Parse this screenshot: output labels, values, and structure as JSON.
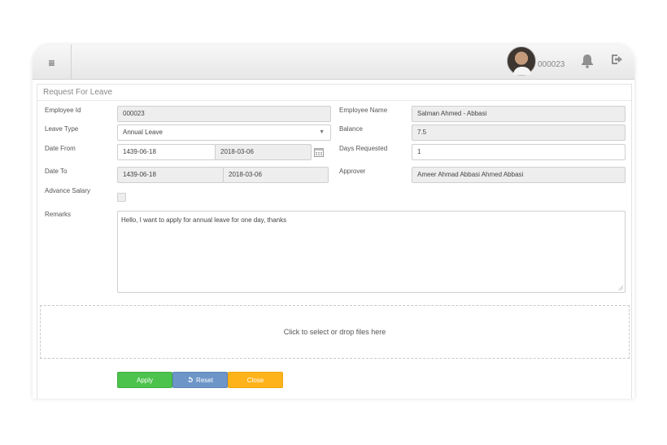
{
  "header": {
    "menu_icon": "hamburger-icon",
    "user_id": "000023",
    "notifications_icon": "bell-icon",
    "logout_icon": "logout-icon"
  },
  "form": {
    "title": "Request For Leave",
    "employee_id": {
      "label": "Employee Id",
      "value": "000023"
    },
    "employee_name": {
      "label": "Employee Name",
      "value": "Salman Ahmed - Abbasi"
    },
    "leave_type": {
      "label": "Leave Type",
      "value": "Annual Leave"
    },
    "balance": {
      "label": "Balance",
      "value": "7.5"
    },
    "date_from": {
      "label": "Date From",
      "hijri": "1439-06-18",
      "gregorian": "2018-03-06"
    },
    "days_requested": {
      "label": "Days Requested",
      "value": "1"
    },
    "date_to": {
      "label": "Date To",
      "hijri": "1439-06-18",
      "gregorian": "2018-03-06"
    },
    "approver": {
      "label": "Approver",
      "value": "Ameer Ahmad Abbasi Ahmed Abbasi"
    },
    "advance_salary": {
      "label": "Advance Salary",
      "checked": false
    },
    "remarks": {
      "label": "Remarks",
      "value": "Hello, I want to apply for annual leave for one day, thanks"
    },
    "dropzone_text": "Click to select or drop files here"
  },
  "buttons": {
    "apply": "Apply",
    "reset": "Reset",
    "close": "Close"
  },
  "colors": {
    "apply": "#4cc34c",
    "reset": "#6d95c8",
    "close": "#ffb31a"
  }
}
